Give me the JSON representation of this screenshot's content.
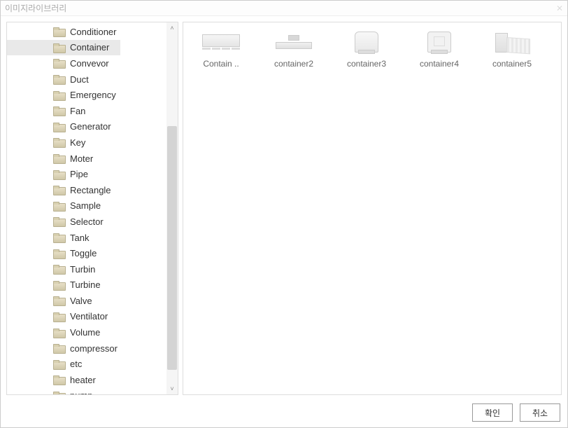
{
  "title": "이미지라이브러리",
  "tree": {
    "items": [
      {
        "label": "Conditioner",
        "selected": false
      },
      {
        "label": "Container",
        "selected": true
      },
      {
        "label": "Convevor",
        "selected": false
      },
      {
        "label": "Duct",
        "selected": false
      },
      {
        "label": "Emergency",
        "selected": false
      },
      {
        "label": "Fan",
        "selected": false
      },
      {
        "label": "Generator",
        "selected": false
      },
      {
        "label": "Key",
        "selected": false
      },
      {
        "label": "Moter",
        "selected": false
      },
      {
        "label": "Pipe",
        "selected": false
      },
      {
        "label": "Rectangle",
        "selected": false
      },
      {
        "label": "Sample",
        "selected": false
      },
      {
        "label": "Selector",
        "selected": false
      },
      {
        "label": "Tank",
        "selected": false
      },
      {
        "label": "Toggle",
        "selected": false
      },
      {
        "label": "Turbin",
        "selected": false
      },
      {
        "label": "Turbine",
        "selected": false
      },
      {
        "label": "Valve",
        "selected": false
      },
      {
        "label": "Ventilator",
        "selected": false
      },
      {
        "label": "Volume",
        "selected": false
      },
      {
        "label": "compressor",
        "selected": false
      },
      {
        "label": "etc",
        "selected": false
      },
      {
        "label": "heater",
        "selected": false
      },
      {
        "label": "pump",
        "selected": false
      }
    ]
  },
  "thumbnails": [
    {
      "label": "Contain .."
    },
    {
      "label": "container2"
    },
    {
      "label": "container3"
    },
    {
      "label": "container4"
    },
    {
      "label": "container5"
    }
  ],
  "buttons": {
    "ok": "확인",
    "cancel": "취소"
  }
}
